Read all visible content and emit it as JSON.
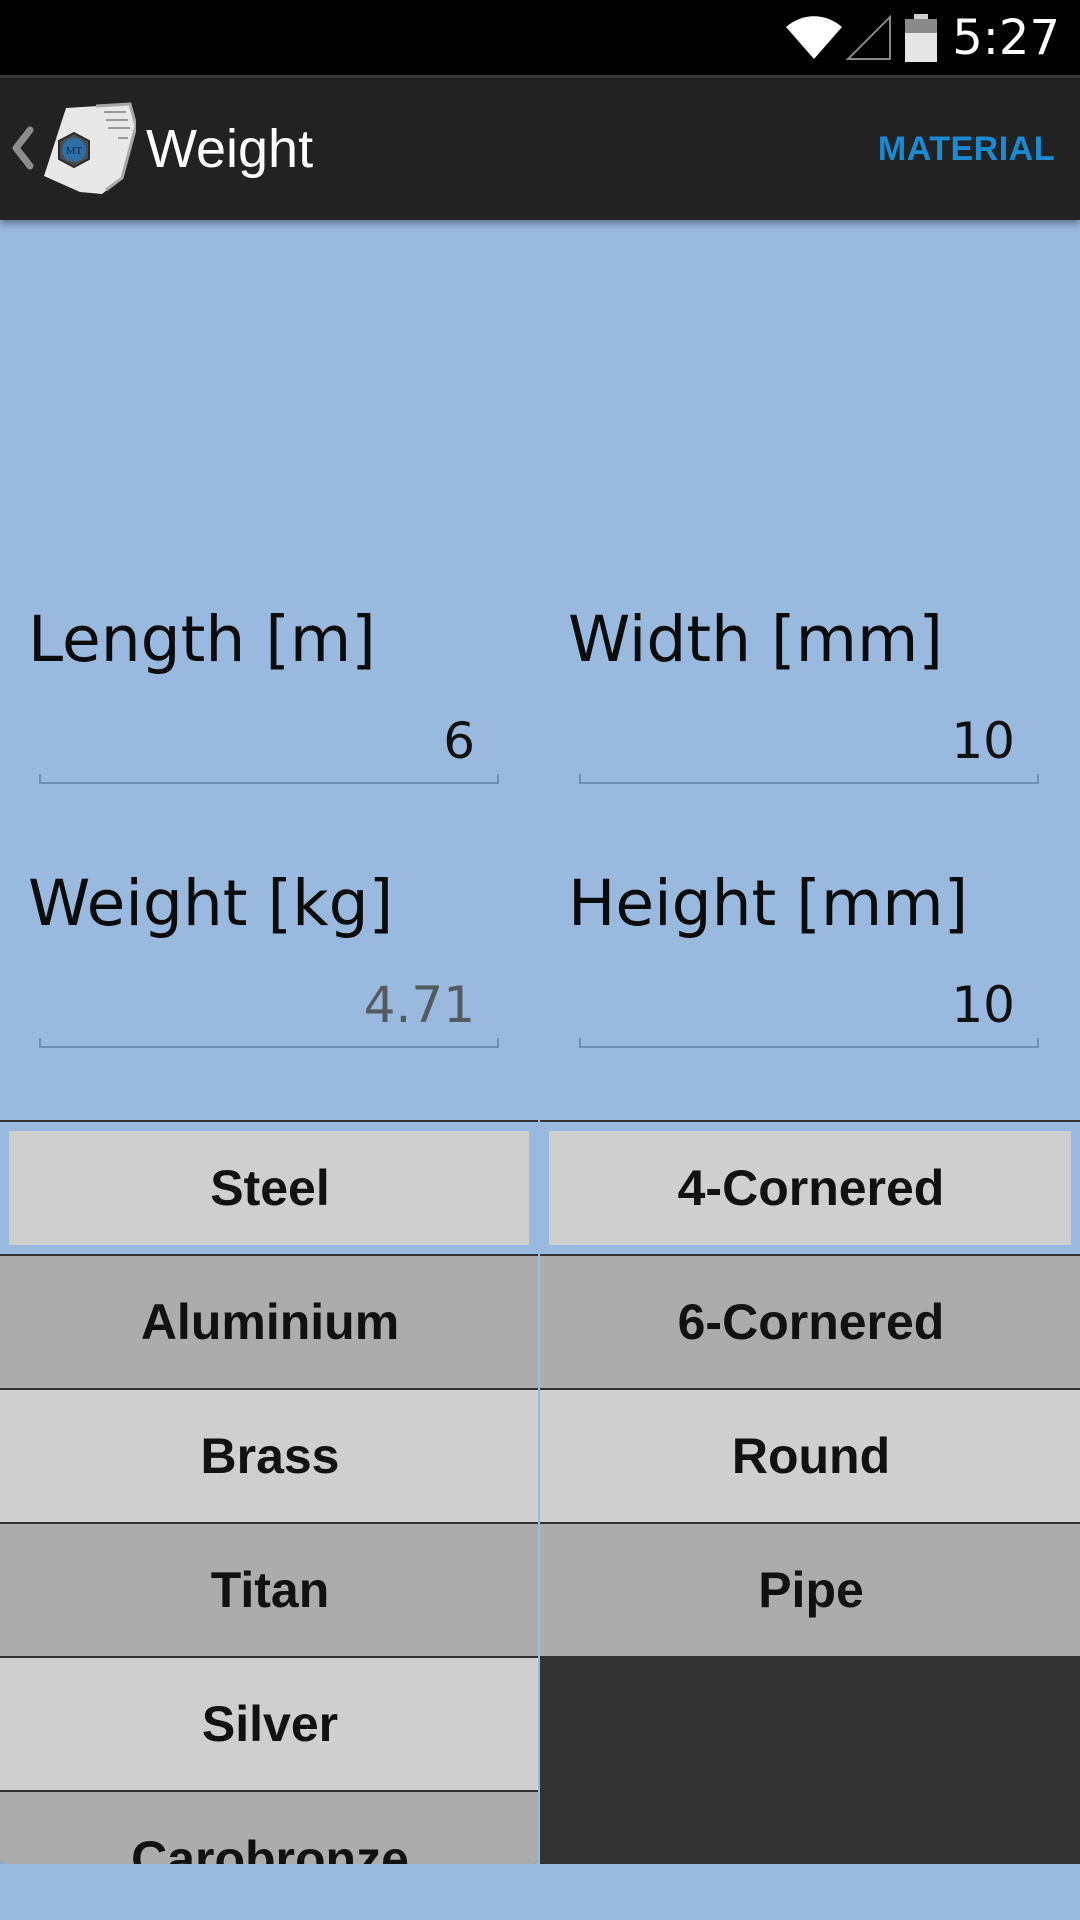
{
  "status_bar": {
    "time": "5:27",
    "icons": [
      "wifi-icon",
      "signal-icon",
      "battery-icon"
    ]
  },
  "action_bar": {
    "title": "Weight",
    "action_label": "MATERIAL",
    "logo_text": "MT",
    "accent_color": "#1a8ad3"
  },
  "form": {
    "length": {
      "label": "Length [m]",
      "value": "6"
    },
    "width": {
      "label": "Width [mm]",
      "value": "10"
    },
    "weight": {
      "label": "Weight [kg]",
      "value": "4.71"
    },
    "height": {
      "label": "Height [mm]",
      "value": "10"
    }
  },
  "materials": {
    "selected": "Steel",
    "items": [
      {
        "label": "Steel"
      },
      {
        "label": "Aluminium"
      },
      {
        "label": "Brass"
      },
      {
        "label": "Titan"
      },
      {
        "label": "Silver"
      },
      {
        "label": "Carobronze"
      }
    ]
  },
  "shapes": {
    "selected": "4-Cornered",
    "items": [
      {
        "label": "4-Cornered"
      },
      {
        "label": "6-Cornered"
      },
      {
        "label": "Round"
      },
      {
        "label": "Pipe"
      }
    ]
  },
  "colors": {
    "background": "#9ab9de",
    "list_light": "#cfcfcf",
    "list_dark": "#acacac",
    "list_empty": "#333333"
  }
}
